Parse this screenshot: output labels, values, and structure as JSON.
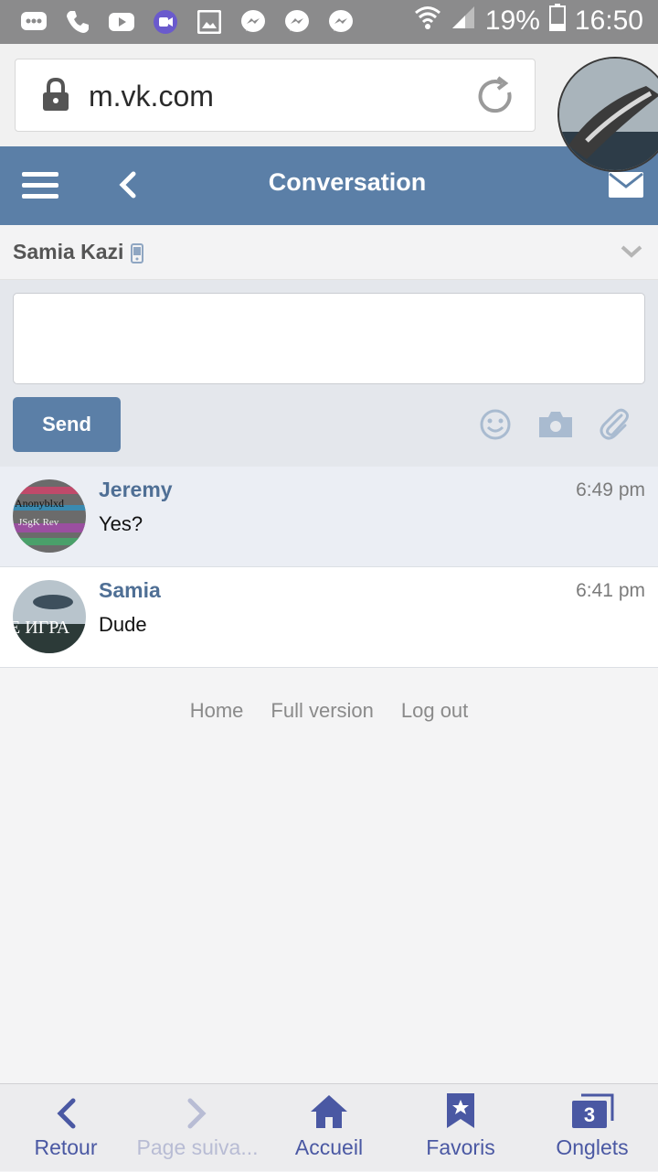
{
  "status_bar": {
    "icons": [
      "chat-bubble-icon",
      "phone-icon",
      "youtube-icon",
      "video-call-icon",
      "gallery-icon",
      "messenger-icon",
      "messenger-icon",
      "messenger-icon"
    ],
    "battery": "19%",
    "time": "16:50"
  },
  "browser": {
    "url": "m.vk.com"
  },
  "navbar": {
    "title": "Conversation"
  },
  "conversation": {
    "contact_name": "Samia Kazi"
  },
  "compose": {
    "message_value": "",
    "send_label": "Send"
  },
  "messages": [
    {
      "author": "Jeremy",
      "time": "6:49 pm",
      "text": "Yes?",
      "avatar_text_1": "Anonyblxd",
      "avatar_text_2": "JSgK Rev"
    },
    {
      "author": "Samia",
      "time": "6:41 pm",
      "text": "Dude",
      "avatar_text_1": "Е ИГРА"
    }
  ],
  "footer": {
    "links": [
      "Home",
      "Full version",
      "Log out"
    ]
  },
  "bottom_nav": {
    "items": [
      {
        "label": "Retour",
        "icon": "chevron-left-icon"
      },
      {
        "label": "Page suiva...",
        "icon": "chevron-right-icon"
      },
      {
        "label": "Accueil",
        "icon": "home-icon"
      },
      {
        "label": "Favoris",
        "icon": "bookmark-star-icon"
      },
      {
        "label": "Onglets",
        "icon": "tabs-icon",
        "count": "3"
      }
    ]
  },
  "colors": {
    "vk_blue": "#5b7fa7",
    "status_bar": "#8b8b8c",
    "browser_accent": "#4a58a3"
  }
}
